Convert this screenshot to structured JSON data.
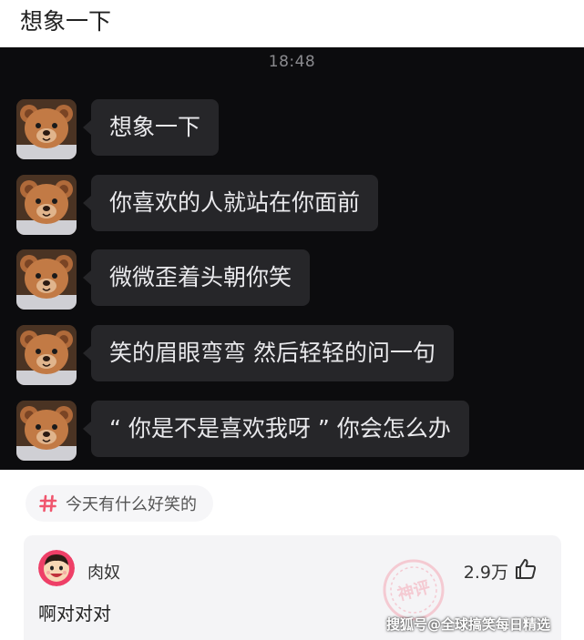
{
  "post": {
    "title": "想象一下"
  },
  "chat": {
    "timestamp": "18:48",
    "messages": [
      {
        "text": "想象一下"
      },
      {
        "text": "你喜欢的人就站在你面前"
      },
      {
        "text": "微微歪着头朝你笑"
      },
      {
        "text": "笑的眉眼弯弯 然后轻轻的问一句"
      },
      {
        "text": "“ 你是不是喜欢我呀 ” 你会怎么办"
      }
    ],
    "colors": {
      "background": "#0c0c0e",
      "bubble": "#262629",
      "text": "#e9e9ec"
    }
  },
  "topic": {
    "icon": "hash-icon",
    "label": "今天有什么好笑的",
    "accent": "#f0566e"
  },
  "comment": {
    "author": "肉奴",
    "likes": "2.9万",
    "like_icon": "thumbs-up-icon",
    "text": "啊对对对",
    "badge_icon": "god-comment-stamp-icon",
    "badge_text": "神评"
  },
  "watermark": {
    "text": "搜狐号@全球搞笑每日精选"
  }
}
